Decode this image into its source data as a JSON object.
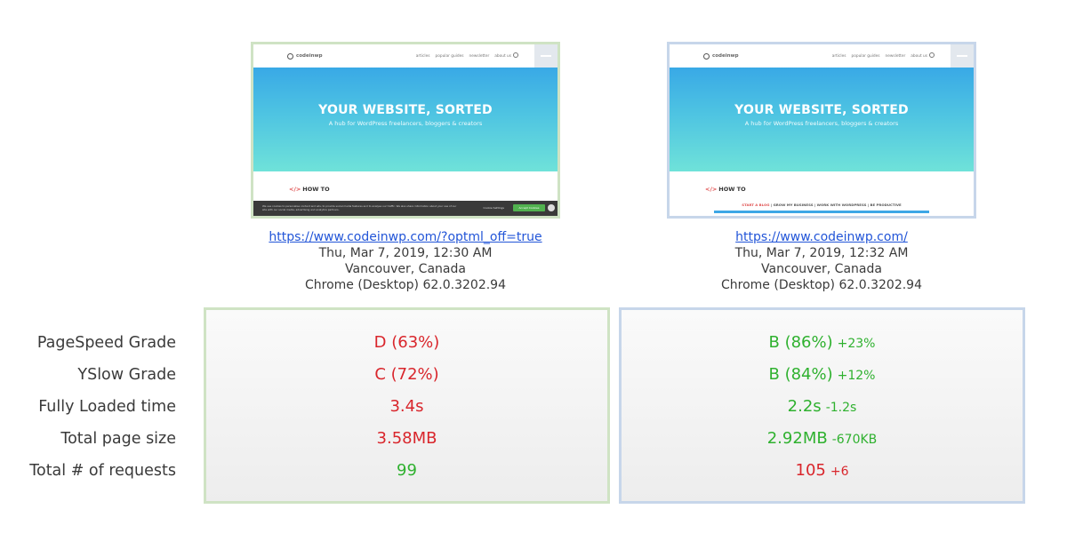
{
  "left": {
    "thumb": {
      "menu": [
        "articles",
        "popular guides",
        "newsletter",
        "about us"
      ],
      "hero_title": "YOUR WEBSITE, SORTED",
      "hero_subtitle": "A hub for WordPress freelancers, bloggers & creators",
      "section": "HOW TO",
      "cookie_text": "We use cookies to personalise content and ads, to provide social media features and to analyse our traffic. We also share information about your use of our site with our social media, advertising and analytics partners.",
      "cookie_settings": "Cookie Settings",
      "cookie_accept": "Accept Cookies"
    },
    "url": "https://www.codeinwp.com/?optml_off=true",
    "date": "Thu, Mar 7, 2019, 12:30 AM",
    "location": "Vancouver, Canada",
    "browser": "Chrome (Desktop) 62.0.3202.94",
    "metrics": [
      {
        "value": "D (63%)",
        "color": "red"
      },
      {
        "value": "C (72%)",
        "color": "red"
      },
      {
        "value": "3.4s",
        "color": "red"
      },
      {
        "value": "3.58MB",
        "color": "red"
      },
      {
        "value": "99",
        "color": "green"
      }
    ]
  },
  "right": {
    "thumb": {
      "menu": [
        "articles",
        "popular guides",
        "newsletter",
        "about us"
      ],
      "hero_title": "YOUR WEBSITE, SORTED",
      "hero_subtitle": "A hub for WordPress freelancers, bloggers & creators",
      "section": "HOW TO",
      "tabs": [
        "START A BLOG",
        "GROW MY BUSINESS",
        "WORK WITH WORDPRESS",
        "BE PRODUCTIVE"
      ]
    },
    "url": "https://www.codeinwp.com/",
    "date": "Thu, Mar 7, 2019, 12:32 AM",
    "location": "Vancouver, Canada",
    "browser": "Chrome (Desktop) 62.0.3202.94",
    "metrics": [
      {
        "value": "B (86%)",
        "delta": "+23%",
        "color": "green"
      },
      {
        "value": "B (84%)",
        "delta": "+12%",
        "color": "green"
      },
      {
        "value": "2.2s",
        "delta": "-1.2s",
        "color": "green"
      },
      {
        "value": "2.92MB",
        "delta": "-670KB",
        "color": "green"
      },
      {
        "value": "105",
        "delta": "+6",
        "color": "red"
      }
    ]
  },
  "labels": [
    "PageSpeed Grade",
    "YSlow Grade",
    "Fully Loaded time",
    "Total page size",
    "Total # of requests"
  ],
  "colors": {
    "red": "#d9262c",
    "green": "#2fb12f",
    "left_border": "#cfe3c4",
    "right_border": "#c7d6ea"
  }
}
